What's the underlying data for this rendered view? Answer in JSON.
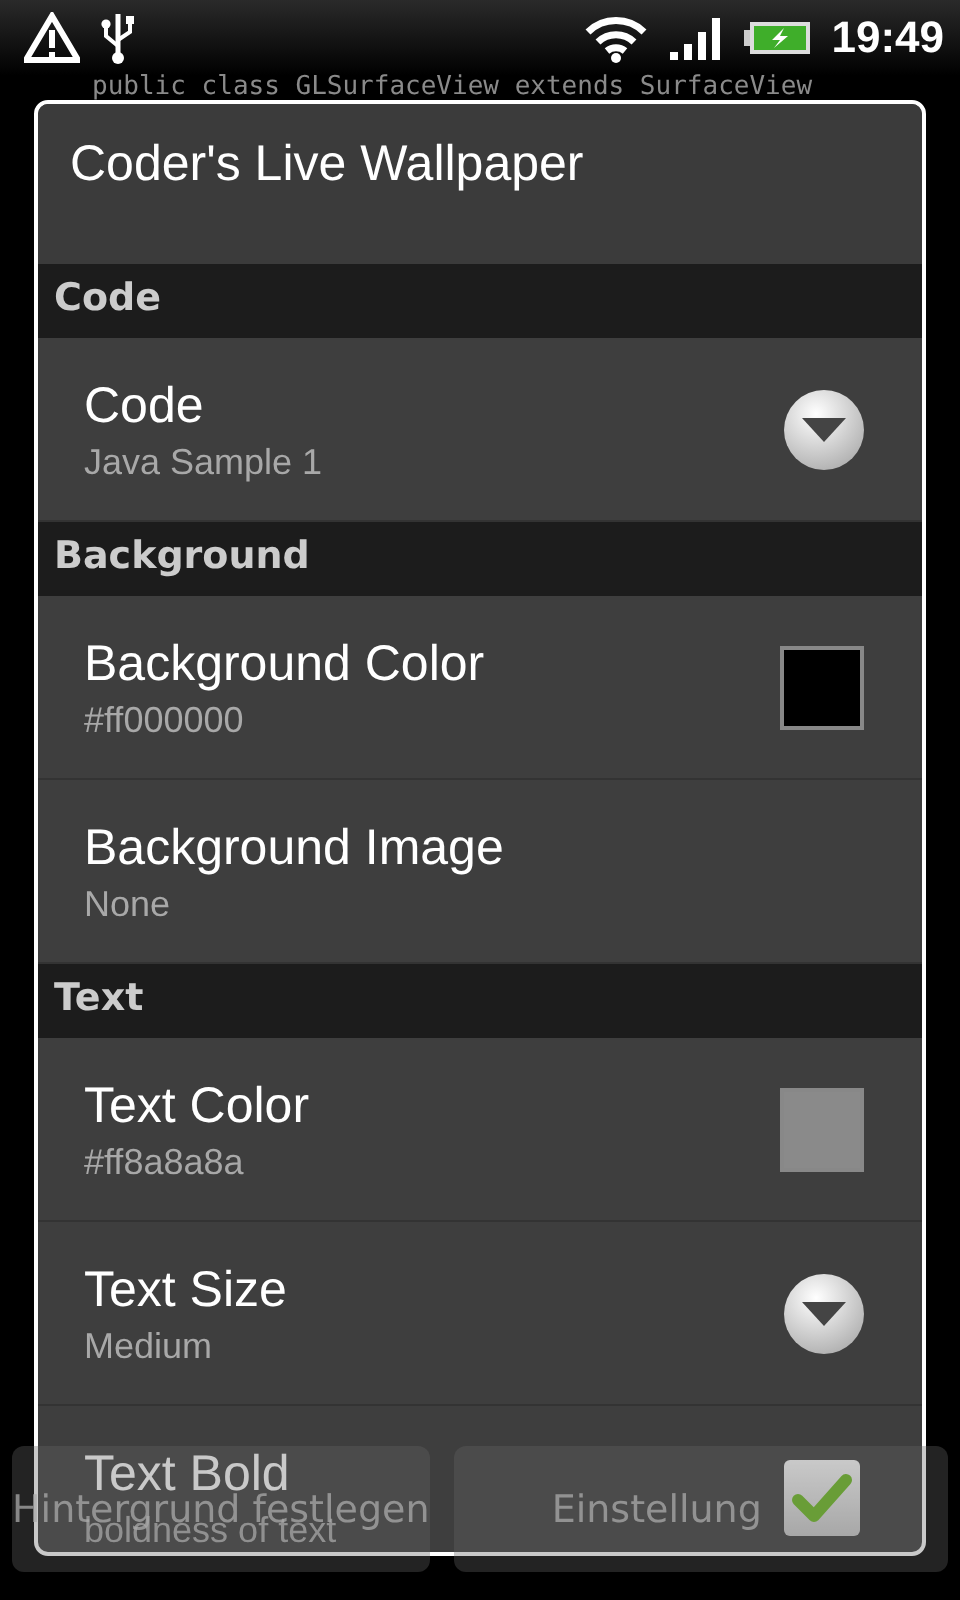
{
  "status_bar": {
    "time": "19:49"
  },
  "background": {
    "code_line": "public class GLSurfaceView extends SurfaceView",
    "buttons": [
      "Hintergrund festlegen",
      "Einstellung"
    ]
  },
  "dialog": {
    "title": "Coder's Live Wallpaper",
    "sections": [
      {
        "header": "Code",
        "items": [
          {
            "kind": "list",
            "title": "Code",
            "summary": "Java Sample 1"
          }
        ]
      },
      {
        "header": "Background",
        "items": [
          {
            "kind": "color",
            "title": "Background Color",
            "summary": "#ff000000",
            "color": "#000000"
          },
          {
            "kind": "plain",
            "title": "Background Image",
            "summary": "None"
          }
        ]
      },
      {
        "header": "Text",
        "items": [
          {
            "kind": "color",
            "title": "Text Color",
            "summary": "#ff8a8a8a",
            "color": "#8a8a8a"
          },
          {
            "kind": "list",
            "title": "Text Size",
            "summary": "Medium"
          },
          {
            "kind": "checkbox",
            "title": "Text Bold",
            "summary": "boldness of text",
            "checked": true
          }
        ]
      }
    ]
  }
}
